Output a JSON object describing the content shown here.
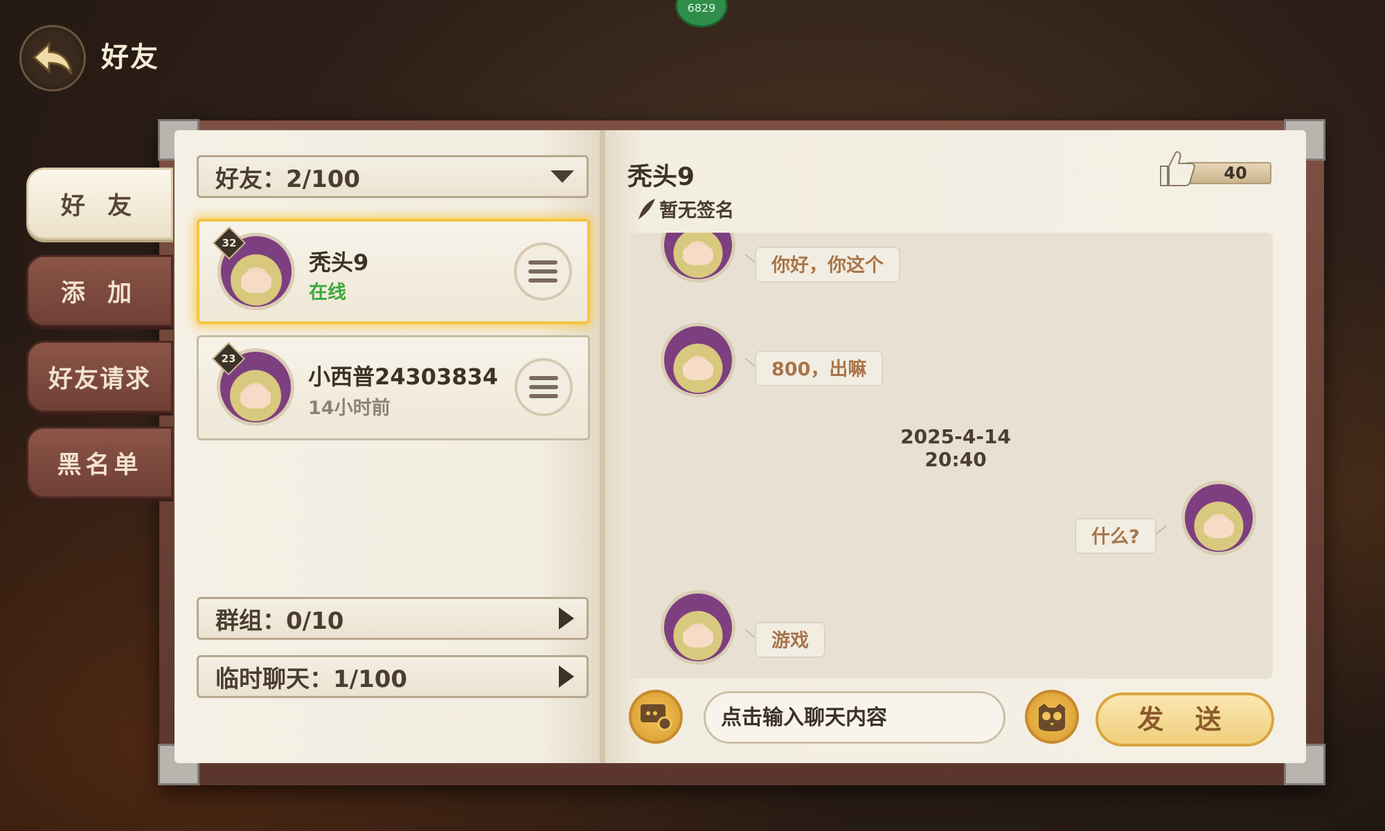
{
  "top_badge": "6829",
  "header": {
    "title": "好友"
  },
  "tabs": [
    {
      "label": "好 友",
      "active": true
    },
    {
      "label": "添 加",
      "active": false
    },
    {
      "label": "好友请求",
      "active": false
    },
    {
      "label": "黑名单",
      "active": false
    }
  ],
  "friends_bar": {
    "label": "好友：2/100"
  },
  "friends": [
    {
      "name": "秃头9",
      "status": "在线",
      "status_color": "#3aa73a",
      "level": "32",
      "selected": true
    },
    {
      "name": "小西普24303834",
      "status": "14小时前",
      "status_color": "#8e8275",
      "level": "23",
      "selected": false
    }
  ],
  "group_bar": {
    "label": "群组：0/10"
  },
  "temp_chat_bar": {
    "label": "临时聊天：1/100"
  },
  "chat": {
    "name": "秃头9",
    "signature": "暂无签名",
    "likes": "40",
    "messages": [
      {
        "side": "left",
        "text": "你好，你这个"
      },
      {
        "side": "left",
        "text": "800，出嘛"
      },
      {
        "timestamp": "2025-4-14   20:40"
      },
      {
        "side": "right",
        "text": "什么?"
      },
      {
        "side": "left",
        "text": "游戏"
      }
    ]
  },
  "input": {
    "placeholder": "点击输入聊天内容"
  },
  "send_label": "发 送",
  "colors": {
    "accent_gold": "#f4c542",
    "online": "#3aa73a",
    "tab_inactive": "#7d4a3f"
  }
}
